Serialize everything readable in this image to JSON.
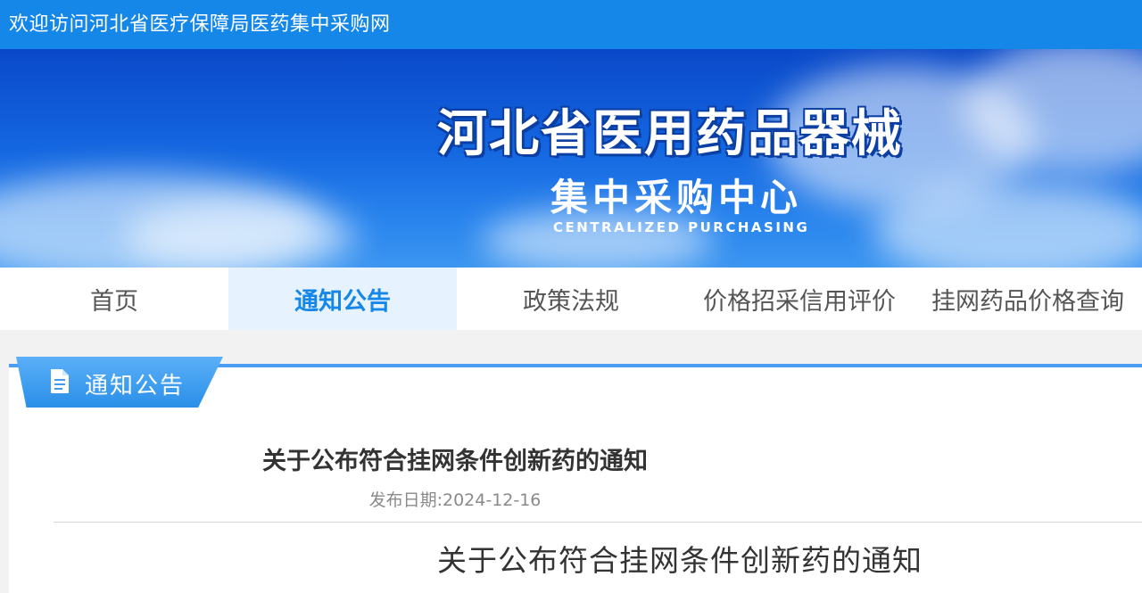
{
  "topbar": {
    "welcome_text": "欢迎访问河北省医疗保障局医药集中采购网"
  },
  "banner": {
    "title_main": "河北省医用药品器械",
    "title_sub": "集中采购中心",
    "title_en": "CENTRALIZED PURCHASING"
  },
  "nav": {
    "items": [
      {
        "label": "首页",
        "active": false
      },
      {
        "label": "通知公告",
        "active": true
      },
      {
        "label": "政策法规",
        "active": false
      },
      {
        "label": "价格招采信用评价",
        "active": false
      },
      {
        "label": "挂网药品价格查询",
        "active": false
      }
    ]
  },
  "section": {
    "label": "通知公告",
    "icon": "document-icon"
  },
  "article": {
    "title": "关于公布符合挂网条件创新药的通知",
    "publish_date": "发布日期:2024-12-16",
    "body_heading": "关于公布符合挂网条件创新药的通知"
  },
  "colors": {
    "brand_blue": "#1587e8",
    "nav_active_bg": "#e6f2fe",
    "text_dark": "#333333",
    "text_muted": "#8a8a8a"
  }
}
